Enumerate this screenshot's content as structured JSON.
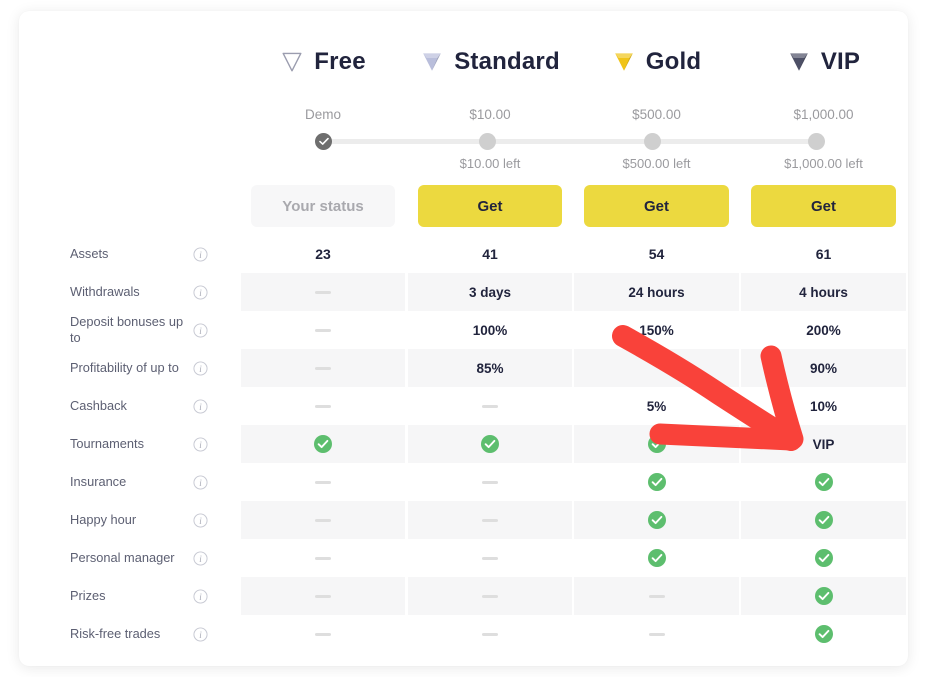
{
  "tiers": [
    {
      "name": "Free",
      "icon": "diamond-outline-icon",
      "icon_color": "#ffffff",
      "price": "Demo",
      "left": "",
      "button": "Your status",
      "button_state": "disabled"
    },
    {
      "name": "Standard",
      "icon": "diamond-silver-icon",
      "icon_color": "#b9bedb",
      "price": "$10.00",
      "left": "$10.00 left",
      "button": "Get",
      "button_state": "active"
    },
    {
      "name": "Gold",
      "icon": "diamond-gold-icon",
      "icon_color": "#f0c419",
      "price": "$500.00",
      "left": "$500.00 left",
      "button": "Get",
      "button_state": "active"
    },
    {
      "name": "VIP",
      "icon": "diamond-black-icon",
      "icon_color": "#4d5066",
      "price": "$1,000.00",
      "left": "$1,000.00 left",
      "button": "Get",
      "button_state": "active"
    }
  ],
  "slider": {
    "nodes": [
      {
        "state": "completed",
        "tier": "Free"
      },
      {
        "state": "pending",
        "tier": "Standard"
      },
      {
        "state": "pending",
        "tier": "Gold"
      },
      {
        "state": "pending",
        "tier": "VIP"
      }
    ]
  },
  "features": [
    {
      "label": "Assets",
      "info": "info-icon",
      "striped": false,
      "values": [
        "23",
        "41",
        "54",
        "61"
      ]
    },
    {
      "label": "Withdrawals",
      "info": "info-icon",
      "striped": true,
      "values": [
        "—",
        "3 days",
        "24 hours",
        "4 hours"
      ]
    },
    {
      "label": "Deposit bonuses up to",
      "info": "info-icon",
      "striped": false,
      "values": [
        "—",
        "100%",
        "150%",
        "200%"
      ]
    },
    {
      "label": "Profitability of up to",
      "info": "info-icon",
      "striped": true,
      "values": [
        "—",
        "85%",
        "",
        "90%"
      ]
    },
    {
      "label": "Cashback",
      "info": "info-icon",
      "striped": false,
      "values": [
        "—",
        "—",
        "5%",
        "10%"
      ]
    },
    {
      "label": "Tournaments",
      "info": "info-icon",
      "striped": true,
      "values": [
        "check",
        "check",
        "check",
        "VIP"
      ]
    },
    {
      "label": "Insurance",
      "info": "info-icon",
      "striped": false,
      "values": [
        "—",
        "—",
        "check",
        "check"
      ]
    },
    {
      "label": "Happy hour",
      "info": "info-icon",
      "striped": true,
      "values": [
        "—",
        "—",
        "check",
        "check"
      ]
    },
    {
      "label": "Personal manager",
      "info": "info-icon",
      "striped": false,
      "values": [
        "—",
        "—",
        "check",
        "check"
      ]
    },
    {
      "label": "Prizes",
      "info": "info-icon",
      "striped": true,
      "values": [
        "—",
        "—",
        "—",
        "check"
      ]
    },
    {
      "label": "Risk-free trades",
      "info": "info-icon",
      "striped": false,
      "values": [
        "—",
        "—",
        "—",
        "check"
      ]
    }
  ],
  "annotation": {
    "type": "arrow",
    "color": "#f9423a",
    "points_to": "vip-column-tournaments-cell"
  },
  "colors": {
    "accent_yellow": "#ecd93f",
    "check_green": "#5dbe6e",
    "text_dark": "#21243d",
    "text_muted": "#9a9a9e",
    "stripe": "#f6f6f7",
    "arrow_red": "#f9423a"
  }
}
